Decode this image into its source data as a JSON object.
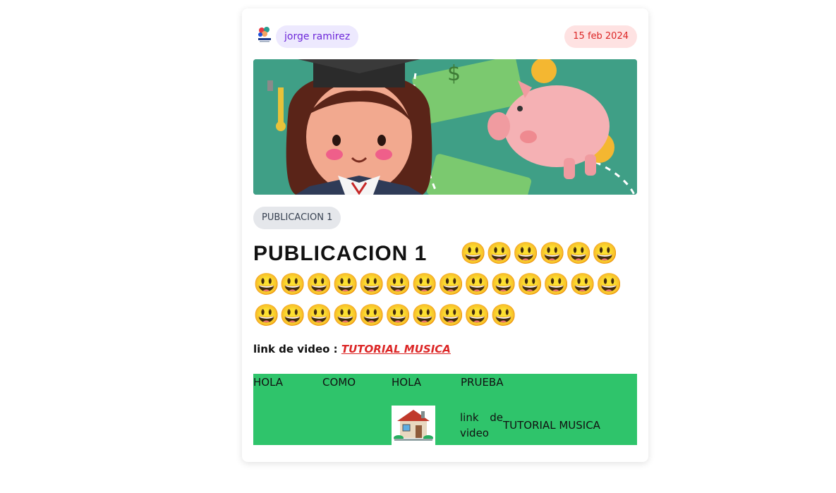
{
  "post": {
    "author": "jorge ramirez",
    "date": "15 feb 2024",
    "tag": "PUBLICACION 1",
    "title_text": "PUBLICACION  1",
    "title_emojis": "😃😃😃😃😃😃😃😃😃😃😃😃😃😃😃😃😃😃😃😃😃😃😃😃😃😃😃😃😃😃",
    "link_label": "link de video  :",
    "link_text": "TUTORIAL MUSICA "
  },
  "table": {
    "headers": [
      "HOLA",
      "COMO",
      "HOLA",
      "PRUEBA"
    ],
    "thumb_icon": "house-icon",
    "video_label": "link de video",
    "video_link": "TUTORIAL MUSICA"
  },
  "colors": {
    "author_bg": "#ede9fe",
    "date_bg": "#fee2e2",
    "link": "#dc2626",
    "table_bg": "#2fc46b"
  }
}
